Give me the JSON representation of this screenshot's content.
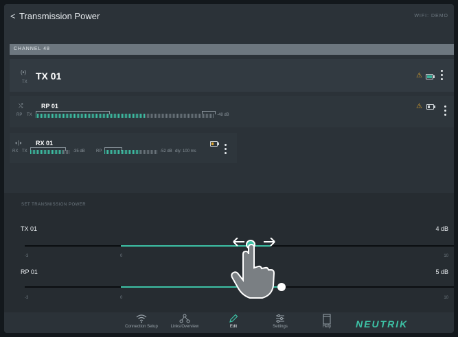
{
  "header": {
    "back": "<",
    "title": "Transmission Power",
    "wifi": "WIFI: DEMO"
  },
  "channel": {
    "label": "CHANNEL 48"
  },
  "tx_card": {
    "icon": "(•)",
    "sub": "TX",
    "name": "TX 01",
    "warn": "⚠",
    "battery": 1.0
  },
  "rp_card": {
    "icon": "⤮",
    "sub": "RP",
    "name": "RP 01",
    "meter_tx_label": "TX",
    "meter_value": "-48 dB",
    "warn": "⚠",
    "battery": 0.3
  },
  "rx_card": {
    "icon": "◖|◗",
    "sub": "RX",
    "name": "RX 01",
    "tx_label": "TX",
    "tx_value": "-35 dB",
    "rp_label": "RP",
    "rp_value": "-52 dB",
    "delay": "dly: 100 ms",
    "battery": 0.3
  },
  "power": {
    "section_title": "SET TRANSMISSION POWER",
    "sliders": [
      {
        "label": "TX 01",
        "value": "4 dB",
        "min": "-3",
        "zero": "0",
        "max": "10"
      },
      {
        "label": "RP 01",
        "value": "5 dB",
        "min": "-3",
        "zero": "0",
        "max": "10"
      }
    ]
  },
  "nav": {
    "items": [
      {
        "label": "Connection Setup",
        "icon": "wifi-icon"
      },
      {
        "label": "Links/Overview",
        "icon": "network-icon"
      },
      {
        "label": "Edit",
        "icon": "pencil-icon"
      },
      {
        "label": "Settings",
        "icon": "sliders-icon"
      },
      {
        "label": "Help",
        "icon": "book-icon"
      }
    ],
    "active": "Edit"
  },
  "brand": {
    "logo": "NEUTRIK",
    "accent": "#3dc2a6"
  }
}
